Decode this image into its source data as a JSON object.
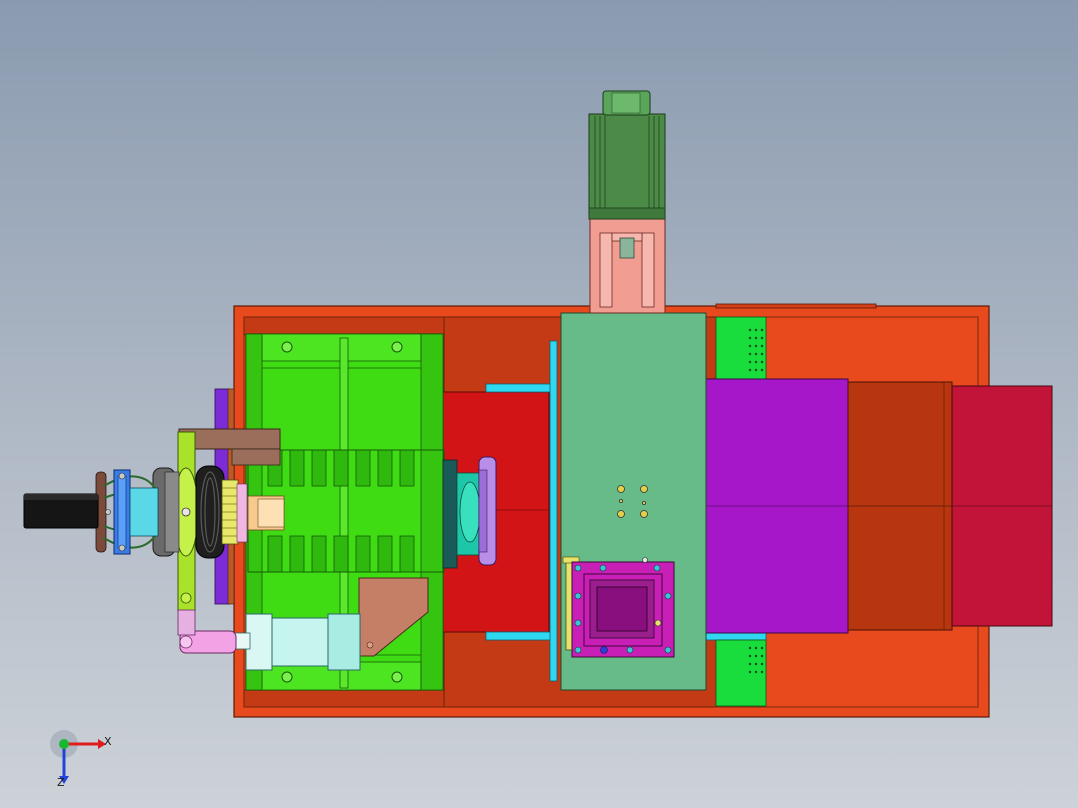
{
  "view": {
    "background_top": "#8a9bb0",
    "background_bottom": "#cdd2d8"
  },
  "triad": {
    "x_label": "X",
    "z_label": "Z",
    "colors": {
      "x": "#e01b1b",
      "y": "#18b833",
      "z": "#2444d8"
    }
  },
  "parts": {
    "base_frame": "#e84a1d",
    "base_plate": "#c33a15",
    "gear_housing": "#3fdc14",
    "motor": "#4c8a48",
    "motor_mount": "#f29d92",
    "gearbox_panel": "#66bb88",
    "magenta_block": "#a617c9",
    "crimson_block": "#c21439",
    "rust_block": "#b8360f",
    "shaft": "#151515",
    "coupling": "#3b7de8",
    "cylinder": "#c6f4ee",
    "bracket": "#c47f66",
    "flange": "#b88fe8",
    "rail": "#2fd8f0",
    "hatch": "#c81fb7"
  }
}
